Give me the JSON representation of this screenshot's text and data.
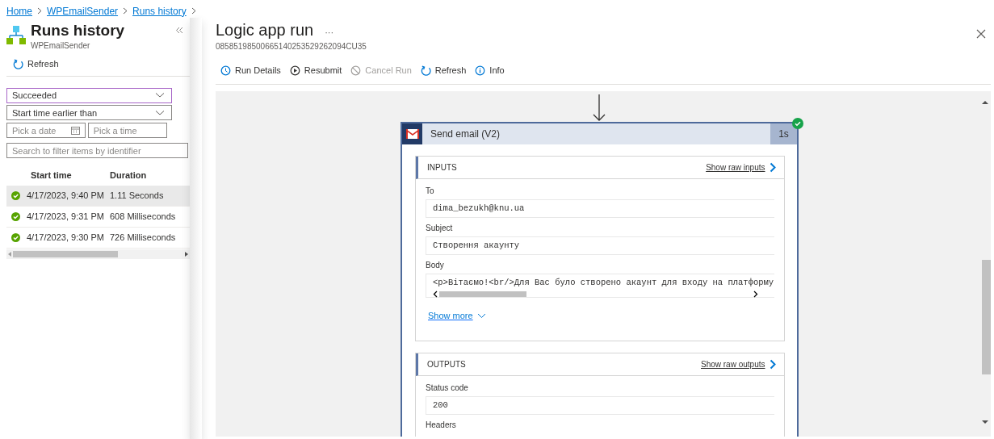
{
  "breadcrumb": [
    "Home",
    "WPEmailSender",
    "Runs history"
  ],
  "sidebar": {
    "title": "Runs history",
    "subtitle": "WPEmailSender",
    "refresh": "Refresh",
    "status_filter": "Succeeded",
    "time_filter": "Start time earlier than",
    "date_placeholder": "Pick a date",
    "time_placeholder": "Pick a time",
    "search_placeholder": "Search to filter items by identifier",
    "columns": [
      "Start time",
      "Duration"
    ],
    "rows": [
      {
        "start": "4/17/2023, 9:40 PM",
        "duration": "1.11 Seconds",
        "selected": true
      },
      {
        "start": "4/17/2023, 9:31 PM",
        "duration": "608 Milliseconds",
        "selected": false
      },
      {
        "start": "4/17/2023, 9:30 PM",
        "duration": "726 Milliseconds",
        "selected": false
      }
    ]
  },
  "run": {
    "title": "Logic app run",
    "more": "···",
    "id": "08585198500665140253529262094CU35",
    "toolbar": [
      {
        "kind": "details",
        "label": "Run Details",
        "disabled": false
      },
      {
        "kind": "resubmit",
        "label": "Resubmit",
        "disabled": false
      },
      {
        "kind": "cancel",
        "label": "Cancel Run",
        "disabled": true
      },
      {
        "kind": "refresh",
        "label": "Refresh",
        "disabled": false
      },
      {
        "kind": "info",
        "label": "Info",
        "disabled": false
      }
    ]
  },
  "action": {
    "title": "Send email (V2)",
    "duration": "1s",
    "succeeded": true,
    "inputs": {
      "heading": "INPUTS",
      "raw_link": "Show raw inputs",
      "fields": [
        {
          "label": "To",
          "value": "dima_bezukh@knu.ua",
          "scroll": false
        },
        {
          "label": "Subject",
          "value": "Створення акаунту",
          "scroll": false
        },
        {
          "label": "Body",
          "value": "<p>Вітаємо!<br/>Для Вас було створено акаунт для входу на платформу",
          "scroll": true
        }
      ],
      "show_more": "Show more"
    },
    "outputs": {
      "heading": "OUTPUTS",
      "raw_link": "Show raw outputs",
      "fields": [
        {
          "label": "Status code",
          "value": "200",
          "scroll": false
        },
        {
          "label": "Headers"
        }
      ]
    }
  }
}
